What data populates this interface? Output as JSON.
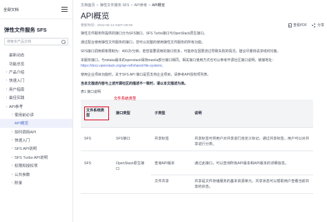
{
  "sidebar": {
    "all_docs": "全部文档",
    "title": "弹性文件服务 SFS",
    "search_placeholder": "搜索本产品文档",
    "items": [
      {
        "label": "最新动态",
        "arrow": ""
      },
      {
        "label": "功能总览",
        "arrow": ""
      },
      {
        "label": "产品介绍",
        "arrow": "›"
      },
      {
        "label": "快速入门",
        "arrow": "›"
      },
      {
        "label": "用户指南",
        "arrow": "›"
      },
      {
        "label": "最佳实践",
        "arrow": "›"
      },
      {
        "label": "API参考",
        "arrow": "⌄"
      },
      {
        "label": "使用前必读",
        "arrow": "›"
      },
      {
        "label": "API概览",
        "arrow": ""
      },
      {
        "label": "如何调用API",
        "arrow": "›"
      },
      {
        "label": "快速入门",
        "arrow": "›"
      },
      {
        "label": "SFS API说明",
        "arrow": "›"
      },
      {
        "label": "SFS Turbo API说明",
        "arrow": "›"
      },
      {
        "label": "权限和授权项",
        "arrow": "›"
      },
      {
        "label": "公共参数",
        "arrow": "›"
      },
      {
        "label": "附录",
        "arrow": "›"
      }
    ]
  },
  "breadcrumb": [
    "文档首页",
    "弹性文件服务 SFS",
    "API参考",
    "API概览"
  ],
  "page": {
    "title": "API概览",
    "updated": "更新时间：2022-06-13 GMT+08:00",
    "pdf_label": "查看PDF",
    "share_label": "分享"
  },
  "content": {
    "p1": "弹性文件服务所提供的接口分为SFS接口、SFS Turbo接口与OpenStack原生接口。",
    "p2": "通过配合使用弹性文件服务的接口，您可以完整的使用弹性文件服务的所有功能。",
    "p3": "SFS接口调用频率限制为：400次/分钟。若您需要调用的接口较多，可能存在因限流过导致失败的情况，建议尽量将请求线时均衡。",
    "p4a": "本服务接口，与mitaka版本的openstack保持manila部分接口相同，相关接口使用方式也可以参考开源社区接口说明，链接地址：",
    "p4b": "https://docs.openstack.org/api-ref/shared-file-system/。",
    "p5": "使用企业项目功能时，关于SFS API 接口是否支持企业项目，请参考API授权项列表。",
    "p6": "当本文描述内容与上述开源社区的描述不一致时，请以本文描述为准。",
    "caption": "表1 接口说明"
  },
  "table": {
    "annotation": "文件系统类型",
    "headers": [
      "文件系统类型",
      "接口类型",
      "子类型",
      "说明"
    ],
    "rows": [
      [
        "SFS",
        "SFS接口",
        "共享标签",
        "共享标签可供用户对共享进行自定义标记。通过共享标签，用户可以对共享进行分类。"
      ],
      [
        "SFS",
        "OpenStack原生接口",
        "查询API版本",
        "通过此接口，可以查询所有API版本和API版本的详细信息。"
      ],
      [
        "",
        "",
        "文件共享",
        "共享是文件存储服务的基本资源单元，共享状态可以帮助用户查看当前共享的状态。"
      ]
    ]
  }
}
